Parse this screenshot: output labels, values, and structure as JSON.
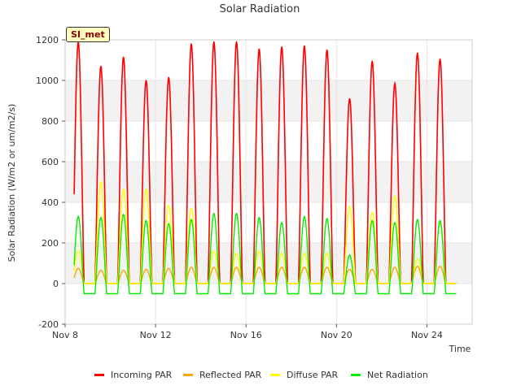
{
  "chart_data": {
    "type": "line",
    "title": "Solar Radiation",
    "xlabel": "Time",
    "ylabel": "Solar Radiation (W/m2 or um/m2/s)",
    "badge": "SI_met",
    "x_ticks": [
      "Nov 8",
      "Nov 12",
      "Nov 16",
      "Nov 20",
      "Nov 24"
    ],
    "x_tick_days": [
      8,
      12,
      16,
      20,
      24
    ],
    "xlim_days": [
      8,
      26.0
    ],
    "y_ticks": [
      "-200",
      "0",
      "200",
      "400",
      "600",
      "800",
      "1000",
      "1200"
    ],
    "ylim": [
      -200,
      1200
    ],
    "grid": true,
    "legend_position": "bottom",
    "colors": {
      "incoming": "#ff0000",
      "reflected": "#ffa500",
      "diffuse": "#ffff00",
      "net": "#00ee00"
    },
    "daily_peak_days": [
      8.58,
      9.58,
      10.58,
      11.58,
      12.58,
      13.58,
      14.58,
      15.58,
      16.58,
      17.58,
      18.58,
      19.58,
      20.58,
      21.58,
      22.58,
      23.58,
      24.58
    ],
    "series": [
      {
        "name": "Incoming PAR",
        "key": "incoming",
        "peaks": [
          1190,
          1070,
          1115,
          1000,
          1015,
          1180,
          1190,
          1190,
          1155,
          1165,
          1170,
          1150,
          910,
          1095,
          985,
          1135,
          1105
        ]
      },
      {
        "name": "Reflected PAR",
        "key": "reflected",
        "peaks": [
          75,
          65,
          65,
          70,
          75,
          80,
          80,
          80,
          80,
          80,
          80,
          80,
          70,
          70,
          80,
          85,
          85
        ]
      },
      {
        "name": "Diffuse PAR",
        "key": "diffuse",
        "peaks": [
          160,
          500,
          465,
          465,
          385,
          370,
          160,
          150,
          160,
          150,
          150,
          150,
          380,
          350,
          430,
          120,
          300
        ]
      },
      {
        "name": "Net Radiation",
        "key": "net",
        "peaks": [
          330,
          325,
          340,
          310,
          295,
          315,
          345,
          345,
          325,
          300,
          330,
          320,
          140,
          310,
          300,
          315,
          310
        ],
        "night_value": -50
      }
    ]
  }
}
